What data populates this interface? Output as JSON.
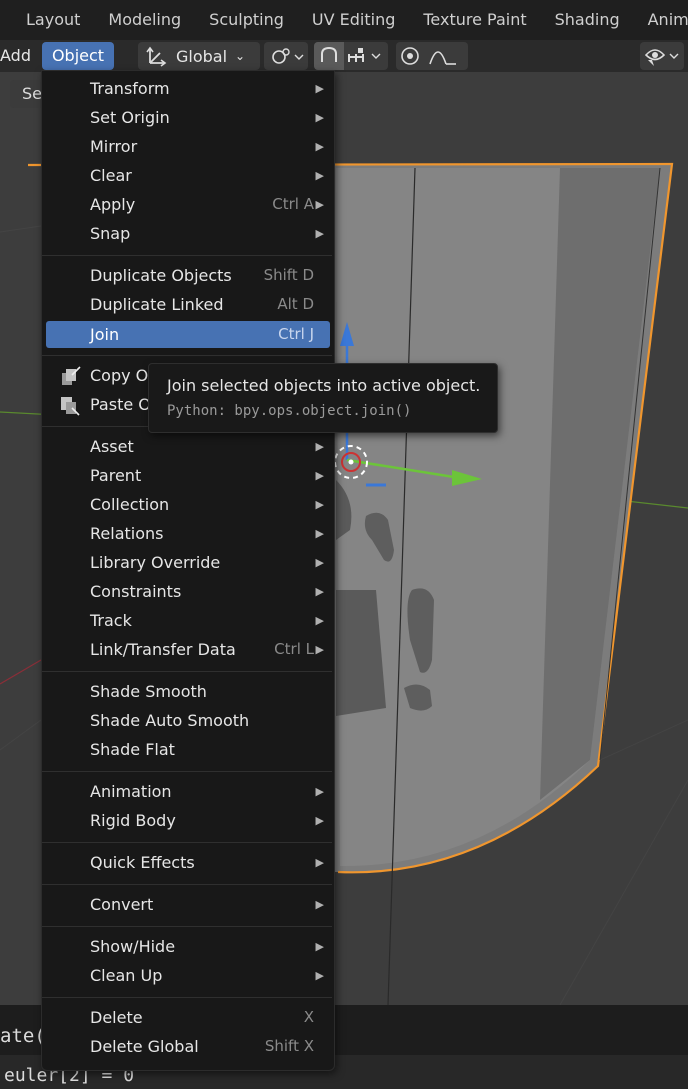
{
  "workspace_tabs": [
    "Layout",
    "Modeling",
    "Sculpting",
    "UV Editing",
    "Texture Paint",
    "Shading",
    "Anim"
  ],
  "toolbar": {
    "add_label": "Add",
    "object_label": "Object",
    "transform_orientation": "Global",
    "select_label": "Se"
  },
  "menu": {
    "items": [
      {
        "label": "Transform",
        "shortcut": "",
        "submenu": true
      },
      {
        "label": "Set Origin",
        "shortcut": "",
        "submenu": true
      },
      {
        "label": "Mirror",
        "shortcut": "",
        "submenu": true
      },
      {
        "label": "Clear",
        "shortcut": "",
        "submenu": true
      },
      {
        "label": "Apply",
        "shortcut": "Ctrl A",
        "submenu": true
      },
      {
        "label": "Snap",
        "shortcut": "",
        "submenu": true
      },
      {
        "label": "Duplicate Objects",
        "shortcut": "Shift D",
        "submenu": false
      },
      {
        "label": "Duplicate Linked",
        "shortcut": "Alt D",
        "submenu": false
      },
      {
        "label": "Join",
        "shortcut": "Ctrl J",
        "submenu": false,
        "highlighted": true
      },
      {
        "label": "Copy Ol",
        "shortcut": "",
        "submenu": false,
        "icon": "copy-icon"
      },
      {
        "label": "Paste O",
        "shortcut": "",
        "submenu": false,
        "icon": "paste-icon"
      },
      {
        "label": "Asset",
        "shortcut": "",
        "submenu": true
      },
      {
        "label": "Parent",
        "shortcut": "",
        "submenu": true
      },
      {
        "label": "Collection",
        "shortcut": "",
        "submenu": true
      },
      {
        "label": "Relations",
        "shortcut": "",
        "submenu": true
      },
      {
        "label": "Library Override",
        "shortcut": "",
        "submenu": true
      },
      {
        "label": "Constraints",
        "shortcut": "",
        "submenu": true
      },
      {
        "label": "Track",
        "shortcut": "",
        "submenu": true
      },
      {
        "label": "Link/Transfer Data",
        "shortcut": "Ctrl L",
        "submenu": true
      },
      {
        "label": "Shade Smooth",
        "shortcut": "",
        "submenu": false
      },
      {
        "label": "Shade Auto Smooth",
        "shortcut": "",
        "submenu": false
      },
      {
        "label": "Shade Flat",
        "shortcut": "",
        "submenu": false
      },
      {
        "label": "Animation",
        "shortcut": "",
        "submenu": true
      },
      {
        "label": "Rigid Body",
        "shortcut": "",
        "submenu": true
      },
      {
        "label": "Quick Effects",
        "shortcut": "",
        "submenu": true
      },
      {
        "label": "Convert",
        "shortcut": "",
        "submenu": true
      },
      {
        "label": "Show/Hide",
        "shortcut": "",
        "submenu": true
      },
      {
        "label": "Clean Up",
        "shortcut": "",
        "submenu": true
      },
      {
        "label": "Delete",
        "shortcut": "X",
        "submenu": false
      },
      {
        "label": "Delete Global",
        "shortcut": "Shift X",
        "submenu": false
      }
    ]
  },
  "tooltip": {
    "description": "Join selected objects into active object.",
    "python": "Python: bpy.ops.object.join()"
  },
  "text_editor": {
    "line1": "ate(",
    "line2": "euler[2] = 0"
  },
  "colors": {
    "accent": "#4772b3",
    "selection_outline": "#f0962e",
    "menu_bg": "#181818"
  }
}
